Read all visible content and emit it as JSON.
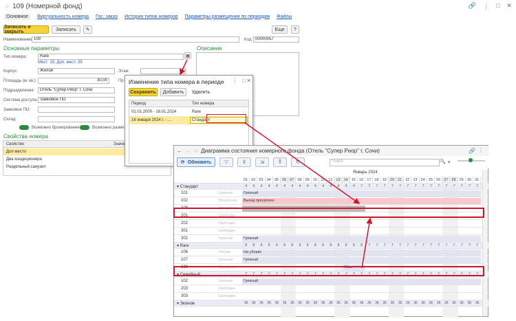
{
  "main_window": {
    "title": "109 (Номерной фонд)",
    "tabs": [
      "Основное",
      "Виртуальность номера",
      "Гос. заказ",
      "История типов номеров",
      "Параметры размещения по периодам",
      "Файлы"
    ],
    "save_close": "Записать и закрыть",
    "save": "Записать",
    "more": "Еще",
    "help": "?",
    "name_label": "Наименование:",
    "name_value": "109",
    "code_label": "Код:",
    "code_value": "00000057",
    "basic_params": "Основные параметры",
    "description": "Описание",
    "room_type_label": "Тип номера:",
    "room_type_value": "Rare",
    "places_info": "Мест: 15,  Доп. мест: 35",
    "building_label": "Корпус:",
    "building_value": "Жилой",
    "floor_label": "Этаж:",
    "area_label": "Площадь (м. кв.):",
    "area_value": "30,00",
    "area_extra": "Пр",
    "department_label": "Подразделение:",
    "department_value": "Отель \"Супер Риор\" г. Сочи",
    "access_label": "Система доступа:",
    "access_value": "Замковое ПО",
    "lock_label": "Замковое ПО:",
    "warehouse_label": "Склад:",
    "booking_possible": "Возможно бронирование",
    "placement_possible": "Возможно размеще...",
    "room_props": "Свойства номера",
    "prop_col": "Свойство",
    "value_col": "Значе",
    "props": [
      "Доп место",
      "Два кондиционера",
      "Раздельный санузел"
    ]
  },
  "dialog": {
    "title": "Изменение типа номера в периоде",
    "save": "Сохранить",
    "add": "Добавить",
    "delete": "Удалить",
    "col_period": "Период",
    "col_type": "Тип номера",
    "rows": [
      {
        "period": "01.01.2000 - 16.01.2024",
        "type": "Rare"
      },
      {
        "period": "16 января 2024 г. - ...",
        "type": "Стандарт"
      }
    ]
  },
  "gantt": {
    "title": "Диаграмма состояния номерного фонда (Отель \"Супер Риор\" г. Сочи)",
    "refresh": "Обновить",
    "search_placeholder": "Поиск",
    "month": "Январь 2024",
    "days": [
      "01",
      "02",
      "03",
      "04",
      "05",
      "06",
      "07",
      "08",
      "09",
      "10",
      "11",
      "12",
      "13",
      "14",
      "15",
      "16",
      "17",
      "18",
      "19",
      "20",
      "21",
      "22",
      "23",
      "24",
      "25",
      "26",
      "27",
      "28",
      "29",
      "30",
      "31"
    ],
    "groups": [
      {
        "name": "Стандарт",
        "counts": [
          "4",
          "4",
          "4",
          "4",
          "4",
          "4",
          "4",
          "4",
          "4",
          "4",
          "4",
          "4",
          "4",
          "4",
          "4",
          "7",
          "7",
          "7",
          "7",
          "7",
          "7",
          "7",
          "7",
          "7",
          "7",
          "7",
          "7",
          "7",
          "7",
          "7",
          "7"
        ]
      },
      {
        "name": "Rare",
        "counts": [
          "8",
          "8",
          "8",
          "8",
          "8",
          "8",
          "8",
          "8",
          "8",
          "8",
          "8",
          "8",
          "8",
          "8",
          "8",
          "8",
          "7",
          "7",
          "7",
          "7",
          "7",
          "7",
          "7",
          "7",
          "7",
          "7",
          "7",
          "7",
          "7",
          "7",
          "7"
        ]
      },
      {
        "name": "Семейный",
        "counts": [
          "7",
          "7",
          "7",
          "7",
          "7",
          "7",
          "7",
          "7",
          "7",
          "7",
          "7",
          "7",
          "7",
          "7",
          "7",
          "7",
          "7",
          "7",
          "7",
          "7",
          "7",
          "7",
          "7",
          "7",
          "7",
          "7",
          "7",
          "7",
          "7",
          "7",
          "7"
        ]
      },
      {
        "name": "Эконом",
        "counts": [
          "36",
          "36",
          "36",
          "36",
          "36",
          "36",
          "36",
          "36",
          "36",
          "36",
          "36",
          "36",
          "36",
          "36",
          "36",
          "36",
          "36",
          "36",
          "36",
          "36",
          "36",
          "36",
          "36",
          "36",
          "36",
          "36",
          "36",
          "36",
          "36",
          "36",
          "36"
        ]
      }
    ],
    "rooms_std": [
      {
        "num": "101",
        "status": "Грязный",
        "note": "Грязный"
      },
      {
        "num": "102",
        "status": "Просрочен",
        "note": "Выезд просрочен"
      },
      {
        "num": "109",
        "status": "Просрочен",
        "note": ""
      },
      {
        "num": "201",
        "status": "Свободен",
        "note": ""
      },
      {
        "num": "202",
        "status": "Свободен",
        "note": ""
      },
      {
        "num": "301",
        "status": "Свободен",
        "note": ""
      },
      {
        "num": "302",
        "status": "Грязный",
        "note": "Грязный"
      }
    ],
    "rooms_rare": [
      {
        "num": "106",
        "status": "Уборка",
        "note": "На уборке"
      },
      {
        "num": "107",
        "status": "Грязный",
        "note": "Грязный"
      },
      {
        "num": "109",
        "status": "Просрочен",
        "note": "Абак"
      }
    ],
    "rooms_fam": [
      {
        "num": "102",
        "status": "Грязный",
        "note": "Грязный"
      },
      {
        "num": "203",
        "status": "Свободен",
        "note": ""
      },
      {
        "num": "303",
        "status": "Свободен",
        "note": ""
      }
    ]
  }
}
